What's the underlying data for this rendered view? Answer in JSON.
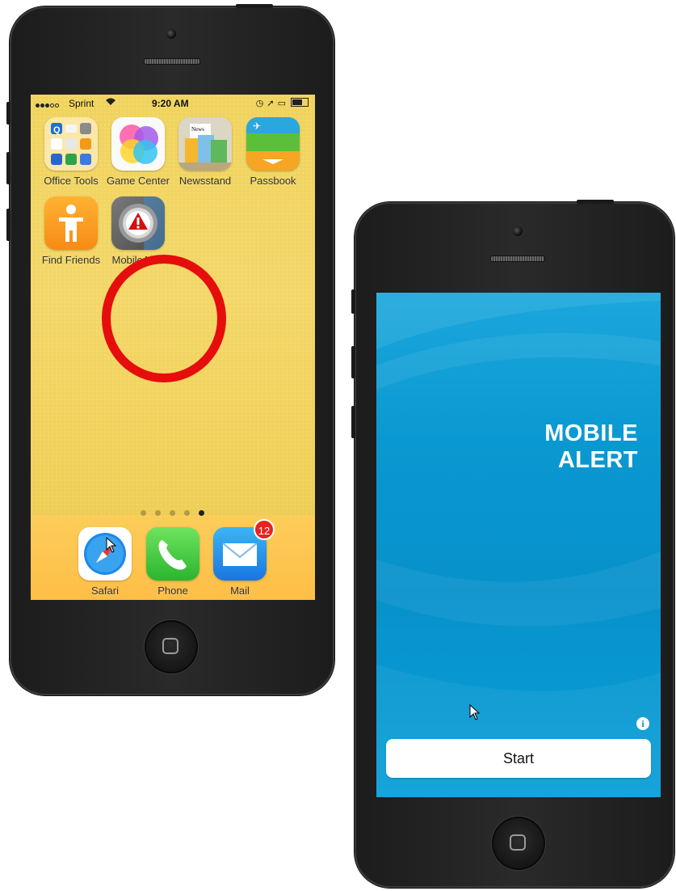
{
  "left_phone": {
    "status_bar": {
      "carrier": "Sprint",
      "time": "9:20 AM"
    },
    "apps": [
      {
        "label": "Office Tools",
        "icon": "office-tools-folder-icon"
      },
      {
        "label": "Game Center",
        "icon": "game-center-icon"
      },
      {
        "label": "Newsstand",
        "icon": "newsstand-icon"
      },
      {
        "label": "Passbook",
        "icon": "passbook-icon"
      },
      {
        "label": "Find Friends",
        "icon": "find-friends-icon"
      },
      {
        "label": "MobileAlert",
        "icon": "mobilealert-icon"
      }
    ],
    "page_indicator": {
      "pages": 5,
      "current": 5
    },
    "dock": [
      {
        "label": "Safari",
        "icon": "safari-icon"
      },
      {
        "label": "Phone",
        "icon": "phone-icon"
      },
      {
        "label": "Mail",
        "icon": "mail-icon",
        "badge": "12"
      }
    ],
    "highlight_color": "#e60d0d"
  },
  "right_phone": {
    "brand_line1": "MOBILE",
    "brand_line2": "ALERT",
    "start_button": "Start",
    "info_icon": "i",
    "background_color": "#0791cb"
  }
}
